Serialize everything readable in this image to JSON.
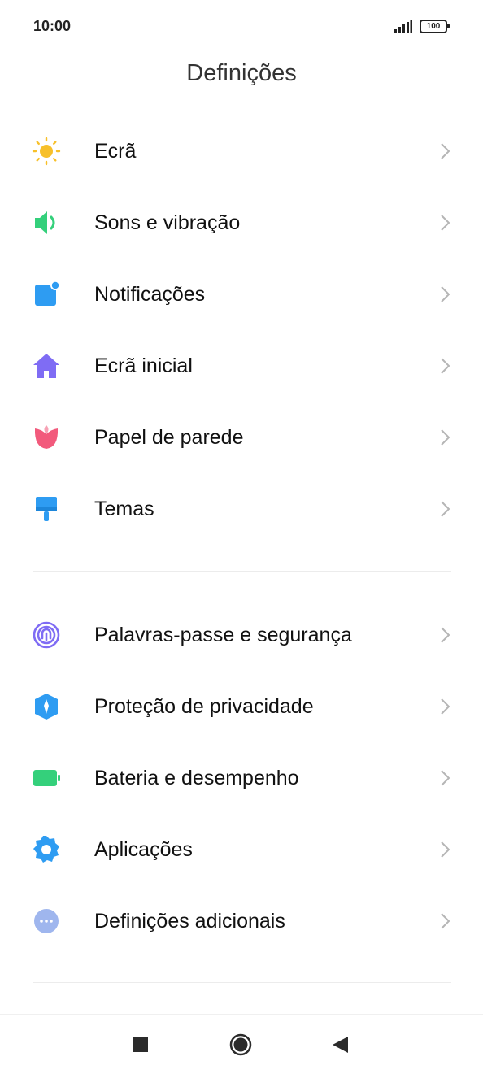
{
  "status_bar": {
    "time": "10:00",
    "battery": "100"
  },
  "header": {
    "title": "Definições"
  },
  "group1": [
    {
      "label": "Ecrã",
      "icon": "sun-icon",
      "color": "#F7C02A"
    },
    {
      "label": "Sons e vibração",
      "icon": "speaker-icon",
      "color": "#34D07B"
    },
    {
      "label": "Notificações",
      "icon": "notification-icon",
      "color": "#2E9CF2"
    },
    {
      "label": "Ecrã inicial",
      "icon": "home-icon",
      "color": "#7F6CF4"
    },
    {
      "label": "Papel de parede",
      "icon": "tulip-icon",
      "color": "#F25A7C"
    },
    {
      "label": "Temas",
      "icon": "paint-brush-icon",
      "color": "#2E9CF2"
    }
  ],
  "group2": [
    {
      "label": "Palavras-passe e segurança",
      "icon": "fingerprint-icon",
      "color": "#7F6CF4"
    },
    {
      "label": "Proteção de privacidade",
      "icon": "privacy-shield-icon",
      "color": "#2E9CF2"
    },
    {
      "label": "Bateria e desempenho",
      "icon": "battery-icon",
      "color": "#34D07B"
    },
    {
      "label": "Aplicações",
      "icon": "gear-icon",
      "color": "#2E9CF2"
    },
    {
      "label": "Definições adicionais",
      "icon": "more-dots-icon",
      "color": "#9FB6EE"
    }
  ],
  "nav_bar": {
    "buttons": [
      "recents-button",
      "home-button",
      "back-button"
    ]
  }
}
